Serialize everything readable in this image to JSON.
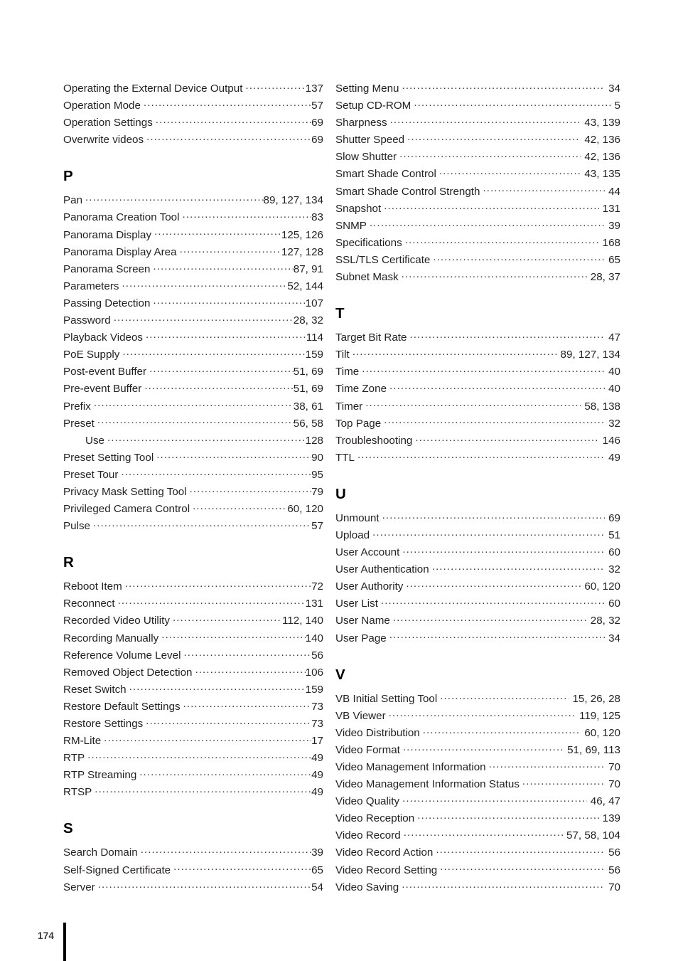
{
  "page": {
    "number": "174",
    "kind": "index"
  },
  "columns": [
    {
      "id": "left",
      "sections": [
        {
          "heading": "",
          "entries": [
            {
              "term": "Operating the External Device Output",
              "pages": "137",
              "sub": false
            },
            {
              "term": "Operation Mode",
              "pages": "57",
              "sub": false
            },
            {
              "term": "Operation Settings",
              "pages": "69",
              "sub": false
            },
            {
              "term": "Overwrite videos",
              "pages": "69",
              "sub": false
            }
          ]
        },
        {
          "heading": "P",
          "entries": [
            {
              "term": "Pan",
              "pages": "89, 127, 134",
              "sub": false
            },
            {
              "term": "Panorama Creation Tool",
              "pages": "83",
              "sub": false
            },
            {
              "term": "Panorama Display",
              "pages": "125, 126",
              "sub": false
            },
            {
              "term": "Panorama Display Area",
              "pages": "127, 128",
              "sub": false
            },
            {
              "term": "Panorama Screen",
              "pages": "87, 91",
              "sub": false
            },
            {
              "term": "Parameters",
              "pages": "52, 144",
              "sub": false
            },
            {
              "term": "Passing Detection",
              "pages": "107",
              "sub": false
            },
            {
              "term": "Password",
              "pages": "28, 32",
              "sub": false
            },
            {
              "term": "Playback Videos",
              "pages": "114",
              "sub": false
            },
            {
              "term": "PoE Supply",
              "pages": "159",
              "sub": false
            },
            {
              "term": "Post-event Buffer",
              "pages": "51, 69",
              "sub": false
            },
            {
              "term": "Pre-event Buffer",
              "pages": "51, 69",
              "sub": false
            },
            {
              "term": "Prefix",
              "pages": "38, 61",
              "sub": false
            },
            {
              "term": "Preset",
              "pages": "56, 58",
              "sub": false
            },
            {
              "term": "Use",
              "pages": "128",
              "sub": true
            },
            {
              "term": "Preset Setting Tool",
              "pages": "90",
              "sub": false
            },
            {
              "term": "Preset Tour",
              "pages": "95",
              "sub": false
            },
            {
              "term": "Privacy Mask Setting Tool",
              "pages": "79",
              "sub": false
            },
            {
              "term": "Privileged Camera Control",
              "pages": "60, 120",
              "sub": false
            },
            {
              "term": "Pulse",
              "pages": "57",
              "sub": false
            }
          ]
        },
        {
          "heading": "R",
          "entries": [
            {
              "term": "Reboot Item",
              "pages": "72",
              "sub": false
            },
            {
              "term": "Reconnect",
              "pages": "131",
              "sub": false
            },
            {
              "term": "Recorded Video Utility",
              "pages": "112, 140",
              "sub": false
            },
            {
              "term": "Recording Manually",
              "pages": "140",
              "sub": false
            },
            {
              "term": "Reference Volume Level",
              "pages": "56",
              "sub": false
            },
            {
              "term": "Removed Object Detection",
              "pages": "106",
              "sub": false
            },
            {
              "term": "Reset Switch",
              "pages": "159",
              "sub": false
            },
            {
              "term": "Restore Default Settings",
              "pages": "73",
              "sub": false
            },
            {
              "term": "Restore Settings",
              "pages": "73",
              "sub": false
            },
            {
              "term": "RM-Lite",
              "pages": "17",
              "sub": false
            },
            {
              "term": "RTP",
              "pages": "49",
              "sub": false
            },
            {
              "term": "RTP Streaming",
              "pages": "49",
              "sub": false
            },
            {
              "term": "RTSP",
              "pages": "49",
              "sub": false
            }
          ]
        },
        {
          "heading": "S",
          "entries": [
            {
              "term": "Search Domain",
              "pages": "39",
              "sub": false
            },
            {
              "term": "Self-Signed Certificate",
              "pages": "65",
              "sub": false
            },
            {
              "term": "Server",
              "pages": "54",
              "sub": false
            }
          ]
        }
      ]
    },
    {
      "id": "right",
      "sections": [
        {
          "heading": "",
          "entries": [
            {
              "term": "Setting Menu",
              "pages": "34",
              "sub": false
            },
            {
              "term": "Setup CD-ROM",
              "pages": "5",
              "sub": false
            },
            {
              "term": "Sharpness",
              "pages": "43, 139",
              "sub": false
            },
            {
              "term": "Shutter Speed",
              "pages": "42, 136",
              "sub": false
            },
            {
              "term": "Slow Shutter",
              "pages": "42, 136",
              "sub": false
            },
            {
              "term": "Smart Shade Control",
              "pages": "43, 135",
              "sub": false
            },
            {
              "term": "Smart Shade Control Strength",
              "pages": "44",
              "sub": false
            },
            {
              "term": "Snapshot",
              "pages": "131",
              "sub": false
            },
            {
              "term": "SNMP",
              "pages": "39",
              "sub": false
            },
            {
              "term": "Specifications",
              "pages": "168",
              "sub": false
            },
            {
              "term": "SSL/TLS Certificate",
              "pages": "65",
              "sub": false
            },
            {
              "term": "Subnet Mask",
              "pages": "28, 37",
              "sub": false
            }
          ]
        },
        {
          "heading": "T",
          "entries": [
            {
              "term": "Target Bit Rate",
              "pages": "47",
              "sub": false
            },
            {
              "term": "Tilt",
              "pages": "89, 127, 134",
              "sub": false
            },
            {
              "term": "Time",
              "pages": "40",
              "sub": false
            },
            {
              "term": "Time Zone",
              "pages": "40",
              "sub": false
            },
            {
              "term": "Timer",
              "pages": "58, 138",
              "sub": false
            },
            {
              "term": "Top Page",
              "pages": "32",
              "sub": false
            },
            {
              "term": "Troubleshooting",
              "pages": "146",
              "sub": false
            },
            {
              "term": "TTL",
              "pages": "49",
              "sub": false
            }
          ]
        },
        {
          "heading": "U",
          "entries": [
            {
              "term": "Unmount",
              "pages": "69",
              "sub": false
            },
            {
              "term": "Upload",
              "pages": "51",
              "sub": false
            },
            {
              "term": "User Account",
              "pages": "60",
              "sub": false
            },
            {
              "term": "User Authentication",
              "pages": "32",
              "sub": false
            },
            {
              "term": "User Authority",
              "pages": "60, 120",
              "sub": false
            },
            {
              "term": "User List",
              "pages": "60",
              "sub": false
            },
            {
              "term": "User Name",
              "pages": "28, 32",
              "sub": false
            },
            {
              "term": "User Page",
              "pages": "34",
              "sub": false
            }
          ]
        },
        {
          "heading": "V",
          "entries": [
            {
              "term": "VB Initial Setting Tool",
              "pages": "15, 26, 28",
              "sub": false
            },
            {
              "term": "VB Viewer",
              "pages": "119, 125",
              "sub": false
            },
            {
              "term": "Video Distribution",
              "pages": "60, 120",
              "sub": false
            },
            {
              "term": "Video Format",
              "pages": "51, 69, 113",
              "sub": false
            },
            {
              "term": "Video Management Information",
              "pages": "70",
              "sub": false
            },
            {
              "term": "Video Management Information Status",
              "pages": "70",
              "sub": false
            },
            {
              "term": "Video Quality",
              "pages": "46, 47",
              "sub": false
            },
            {
              "term": "Video Reception",
              "pages": "139",
              "sub": false
            },
            {
              "term": "Video Record",
              "pages": "57, 58, 104",
              "sub": false
            },
            {
              "term": "Video Record Action",
              "pages": "56",
              "sub": false
            },
            {
              "term": "Video Record Setting",
              "pages": "56",
              "sub": false
            },
            {
              "term": "Video Saving",
              "pages": "70",
              "sub": false
            }
          ]
        }
      ]
    }
  ]
}
